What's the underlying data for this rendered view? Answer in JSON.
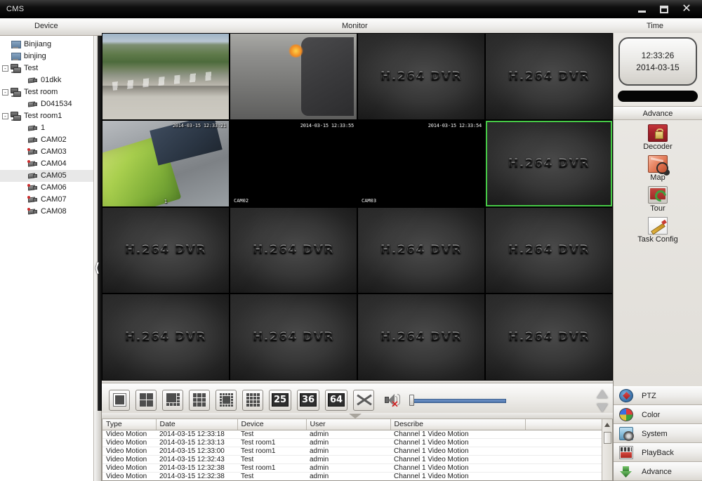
{
  "window": {
    "title": "CMS",
    "buttons": {
      "minimize": "minimize-button",
      "maximize": "maximize-button",
      "close": "close-button"
    }
  },
  "header": {
    "device": "Device",
    "monitor": "Monitor",
    "time": "Time"
  },
  "device_tree": [
    {
      "label": "Binjiang",
      "indent": 0,
      "icon": "pc",
      "expander": "",
      "selected": false
    },
    {
      "label": "binjing",
      "indent": 0,
      "icon": "pc",
      "expander": "",
      "selected": false
    },
    {
      "label": "Test",
      "indent": 0,
      "icon": "group",
      "expander": "-",
      "selected": false
    },
    {
      "label": "01dkk",
      "indent": 2,
      "icon": "camera",
      "expander": "",
      "selected": false
    },
    {
      "label": "Test room",
      "indent": 0,
      "icon": "group",
      "expander": "-",
      "selected": false
    },
    {
      "label": "D041534",
      "indent": 2,
      "icon": "camera",
      "expander": "",
      "selected": false
    },
    {
      "label": "Test room1",
      "indent": 0,
      "icon": "group",
      "expander": "-",
      "selected": false
    },
    {
      "label": "1",
      "indent": 2,
      "icon": "camera",
      "expander": "",
      "selected": false
    },
    {
      "label": "CAM02",
      "indent": 2,
      "icon": "camera",
      "expander": "",
      "selected": false
    },
    {
      "label": "CAM03",
      "indent": 2,
      "icon": "camera-on",
      "expander": "",
      "selected": false
    },
    {
      "label": "CAM04",
      "indent": 2,
      "icon": "camera-on",
      "expander": "",
      "selected": false
    },
    {
      "label": "CAM05",
      "indent": 2,
      "icon": "camera",
      "expander": "",
      "selected": true
    },
    {
      "label": "CAM06",
      "indent": 2,
      "icon": "camera-on",
      "expander": "",
      "selected": false
    },
    {
      "label": "CAM07",
      "indent": 2,
      "icon": "camera-on",
      "expander": "",
      "selected": false
    },
    {
      "label": "CAM08",
      "indent": 2,
      "icon": "camera-on",
      "expander": "",
      "selected": false
    }
  ],
  "monitor": {
    "layout": "4x4",
    "selected_cell_index": 7,
    "selection_color": "#46c946",
    "dvr_watermark": "H.264 DVR",
    "cells": [
      {
        "kind": "video",
        "style": "road",
        "osd_time": "",
        "osd_name": ""
      },
      {
        "kind": "video",
        "style": "street",
        "osd_time": "",
        "osd_name": ""
      },
      {
        "kind": "dvr",
        "style": "",
        "osd_time": "",
        "osd_name": ""
      },
      {
        "kind": "dvr",
        "style": "",
        "osd_time": "",
        "osd_name": ""
      },
      {
        "kind": "video",
        "style": "indoor",
        "osd_time": "2014-03-15 12:33:21",
        "osd_name": "1"
      },
      {
        "kind": "black",
        "style": "",
        "osd_time": "2014-03-15 12:33:55",
        "osd_name": "CAM02"
      },
      {
        "kind": "black",
        "style": "",
        "osd_time": "2014-03-15 12:33:54",
        "osd_name": "CAM03"
      },
      {
        "kind": "dvr",
        "style": "",
        "osd_time": "",
        "osd_name": ""
      },
      {
        "kind": "dvr",
        "style": "",
        "osd_time": "",
        "osd_name": ""
      },
      {
        "kind": "dvr",
        "style": "",
        "osd_time": "",
        "osd_name": ""
      },
      {
        "kind": "dvr",
        "style": "",
        "osd_time": "",
        "osd_name": ""
      },
      {
        "kind": "dvr",
        "style": "",
        "osd_time": "",
        "osd_name": ""
      },
      {
        "kind": "dvr",
        "style": "",
        "osd_time": "",
        "osd_name": ""
      },
      {
        "kind": "dvr",
        "style": "",
        "osd_time": "",
        "osd_name": ""
      },
      {
        "kind": "dvr",
        "style": "",
        "osd_time": "",
        "osd_name": ""
      },
      {
        "kind": "dvr",
        "style": "",
        "osd_time": "",
        "osd_name": ""
      }
    ]
  },
  "toolbar": {
    "layouts": [
      {
        "name": "layout-1",
        "type": "single",
        "label": ""
      },
      {
        "name": "layout-4",
        "type": "grid",
        "cols": 2,
        "rows": 2,
        "label": ""
      },
      {
        "name": "layout-6",
        "type": "grid6",
        "cols": 3,
        "rows": 3,
        "label": ""
      },
      {
        "name": "layout-9",
        "type": "grid",
        "cols": 3,
        "rows": 3,
        "label": ""
      },
      {
        "name": "layout-13",
        "type": "grid13",
        "cols": 4,
        "rows": 4,
        "label": ""
      },
      {
        "name": "layout-16",
        "type": "grid",
        "cols": 4,
        "rows": 4,
        "label": ""
      }
    ],
    "count_buttons": [
      "25",
      "36",
      "64"
    ],
    "fullscreen": "fullscreen-button",
    "audio": {
      "muted": true,
      "volume_percent": 96
    },
    "spinner": "page-spinner"
  },
  "clock": {
    "time": "12:33:26",
    "date": "2014-03-15"
  },
  "advance_panel": {
    "title": "Advance",
    "items": [
      {
        "label": "Decoder",
        "icon": "decoder-icon"
      },
      {
        "label": "Map",
        "icon": "map-icon"
      },
      {
        "label": "Tour",
        "icon": "tour-icon"
      },
      {
        "label": "Task Config",
        "icon": "task-config-icon"
      }
    ]
  },
  "right_menu": [
    {
      "label": "PTZ",
      "icon": "ptz-icon"
    },
    {
      "label": "Color",
      "icon": "color-icon"
    },
    {
      "label": "System",
      "icon": "system-icon"
    },
    {
      "label": "PlayBack",
      "icon": "playback-icon"
    },
    {
      "label": "Advance",
      "icon": "advance-icon"
    }
  ],
  "log": {
    "columns": [
      "Type",
      "Date",
      "Device",
      "User",
      "Describe",
      ""
    ],
    "rows": [
      [
        "Video Motion",
        "2014-03-15 12:33:18",
        "Test",
        "admin",
        "Channel 1 Video Motion",
        ""
      ],
      [
        "Video Motion",
        "2014-03-15 12:33:13",
        "Test room1",
        "admin",
        "Channel 1 Video Motion",
        ""
      ],
      [
        "Video Motion",
        "2014-03-15 12:33:00",
        "Test room1",
        "admin",
        "Channel 1 Video Motion",
        ""
      ],
      [
        "Video Motion",
        "2014-03-15 12:32:43",
        "Test",
        "admin",
        "Channel 1 Video Motion",
        ""
      ],
      [
        "Video Motion",
        "2014-03-15 12:32:38",
        "Test room1",
        "admin",
        "Channel 1 Video Motion",
        ""
      ],
      [
        "Video Motion",
        "2014-03-15 12:32:38",
        "Test",
        "admin",
        "Channel 1 Video Motion",
        ""
      ]
    ]
  }
}
